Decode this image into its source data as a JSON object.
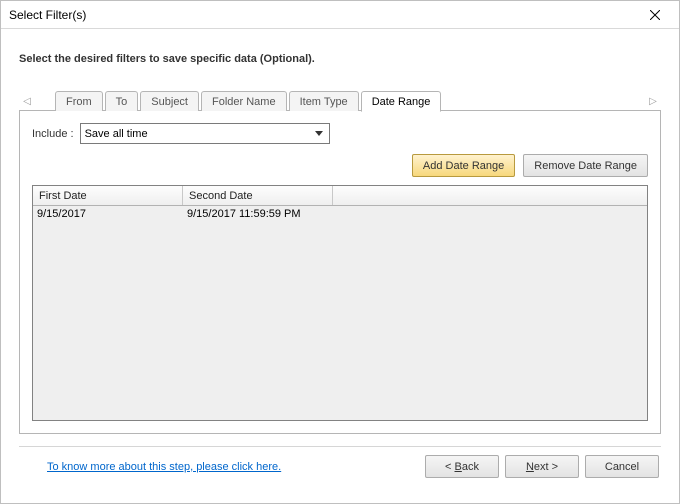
{
  "window": {
    "title": "Select Filter(s)"
  },
  "instruction": "Select the desired filters to save specific data (Optional).",
  "tabs": {
    "from": "From",
    "to": "To",
    "subject": "Subject",
    "folder_name": "Folder Name",
    "item_type": "Item Type",
    "date_range": "Date Range",
    "active": "date_range"
  },
  "include": {
    "label": "Include :",
    "value": "Save all time"
  },
  "buttons": {
    "add_date_range": "Add Date Range",
    "remove_date_range": "Remove Date Range",
    "back_prefix": "< ",
    "back_mn": "B",
    "back_suffix": "ack",
    "next_mn": "N",
    "next_suffix": "ext >",
    "cancel": "Cancel"
  },
  "list": {
    "columns": {
      "first_date": "First Date",
      "second_date": "Second Date"
    },
    "rows": [
      {
        "first": "9/15/2017",
        "second": "9/15/2017 11:59:59 PM"
      }
    ]
  },
  "help_link": "To know more about this step, please click here."
}
